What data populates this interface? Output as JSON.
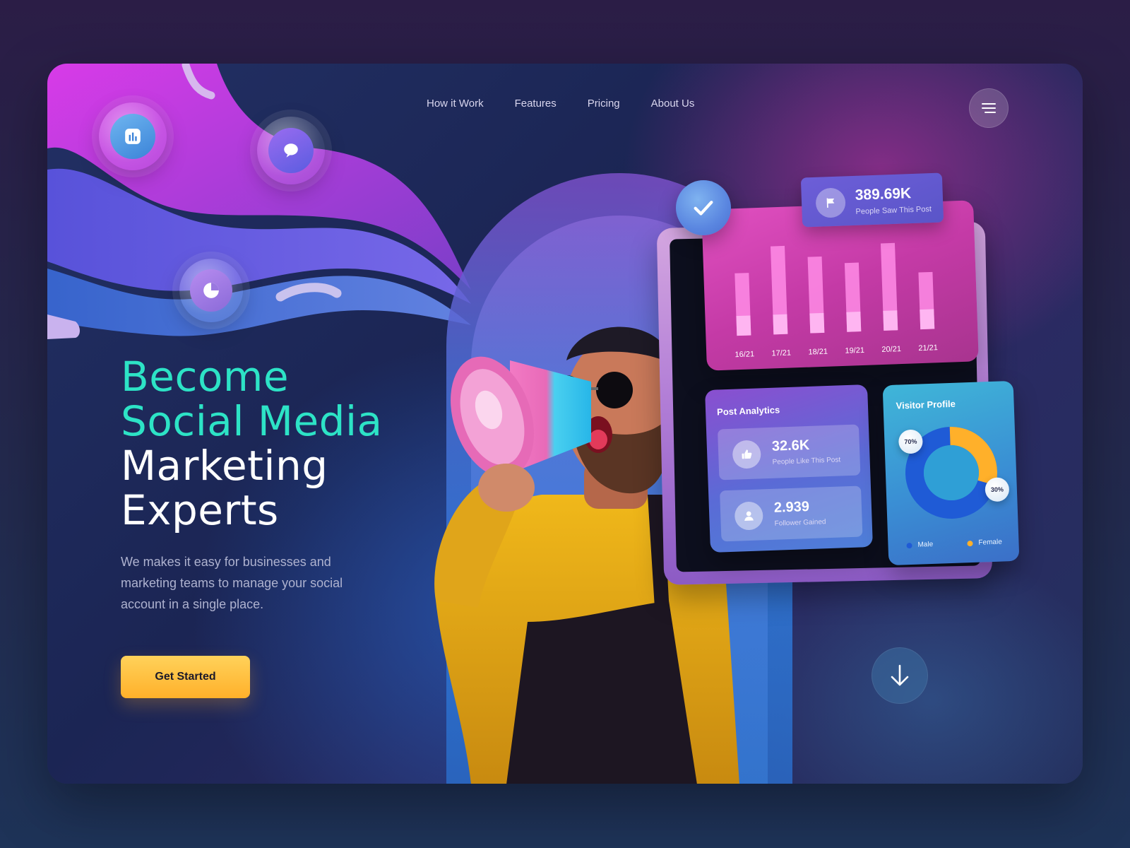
{
  "nav": {
    "items": [
      {
        "label": "How it Work"
      },
      {
        "label": "Features"
      },
      {
        "label": "Pricing"
      },
      {
        "label": "About Us"
      }
    ]
  },
  "hero": {
    "headline_accent": [
      "Become",
      "Social Media"
    ],
    "headline_white": [
      "Marketing",
      "Experts"
    ],
    "description": "We makes it easy for businesses and marketing teams to manage your social account in a single place.",
    "cta_label": "Get Started"
  },
  "dashboard": {
    "reach": {
      "value": "389.69K",
      "label": "People Saw This Post"
    },
    "post_analytics": {
      "title": "Post Analytics",
      "likes": {
        "value": "32.6K",
        "label": "People Like This Post"
      },
      "followers": {
        "value": "2.939",
        "label": "Follower Gained"
      }
    },
    "visitor_profile": {
      "title": "Visitor Profile",
      "male_pct": "70%",
      "female_pct": "30%",
      "legend_male": "Male",
      "legend_female": "Female"
    }
  },
  "chart_data": {
    "type": "bar",
    "categories": [
      "16/21",
      "17/21",
      "18/21",
      "19/21",
      "20/21",
      "21/21"
    ],
    "values": [
      68,
      96,
      83,
      75,
      95,
      62
    ],
    "ylim": [
      0,
      100
    ],
    "grid": false
  },
  "colors": {
    "accent": "#2de3c6",
    "cta": "#ffb02a",
    "male": "#1f5bd6",
    "female": "#ffb02a"
  },
  "icons": {
    "bar_chart": "bar-chart-icon",
    "chat": "chat-bubble-icon",
    "pie": "pie-chart-icon",
    "menu": "hamburger-icon",
    "check": "check-icon",
    "flag": "flag-icon",
    "like": "thumbs-up-icon",
    "user": "user-icon",
    "down": "arrow-down-icon"
  }
}
